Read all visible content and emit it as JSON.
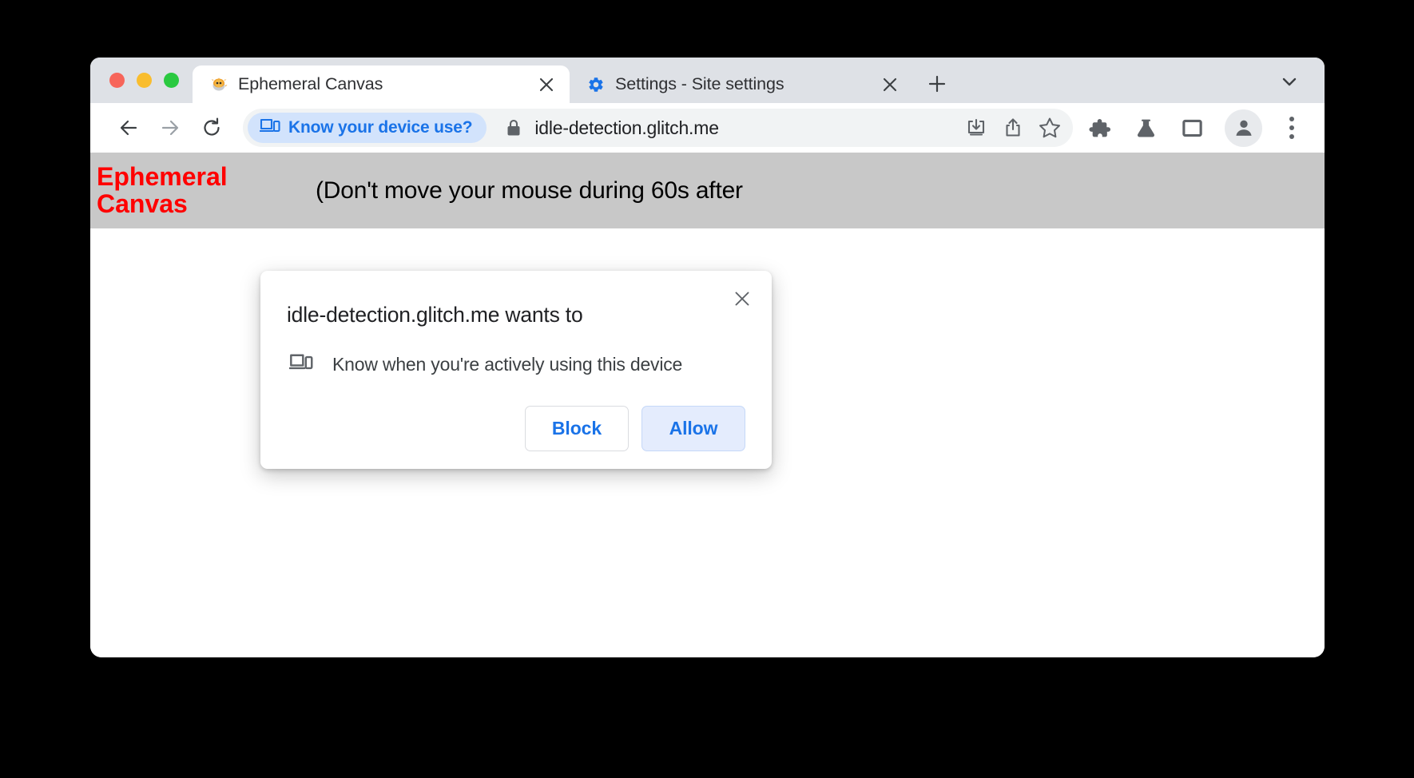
{
  "window": {
    "traffic_lights": [
      "close",
      "minimize",
      "maximize"
    ]
  },
  "tabstrip": {
    "tabs": [
      {
        "title": "Ephemeral Canvas",
        "favicon": "pufferfish-favicon",
        "favicon_glyph": "🐡",
        "active": true,
        "close_label": "✕"
      },
      {
        "title": "Settings - Site settings",
        "favicon": "gear-favicon",
        "favicon_glyph": "⚙",
        "active": false,
        "close_label": "✕"
      }
    ],
    "new_tab_label": "+",
    "tab_search_icon": "chevron-down-icon"
  },
  "toolbar": {
    "back_icon": "back-arrow-icon",
    "forward_icon": "forward-arrow-icon",
    "reload_icon": "reload-icon",
    "permission_chip": {
      "label": "Know your device use?",
      "icon": "device-idle-icon",
      "color": "#1a73e8",
      "background": "#d2e3fc"
    },
    "security_icon": "lock-icon",
    "url": "idle-detection.glitch.me",
    "omnibox_icons": [
      {
        "name": "install-app-icon"
      },
      {
        "name": "share-icon"
      },
      {
        "name": "bookmark-star-icon"
      }
    ],
    "action_icons": [
      {
        "name": "extensions-puzzle-icon"
      },
      {
        "name": "labs-flask-icon"
      },
      {
        "name": "side-panel-icon"
      }
    ],
    "avatar_icon": "profile-avatar-icon",
    "menu_icon": "three-dot-menu-icon"
  },
  "page": {
    "heading": "Ephemeral Canvas",
    "heading_color": "#ff0000",
    "banner_background": "#c8c8c8",
    "subtext": "(Don't move your mouse during 60s after"
  },
  "dialog": {
    "title": "idle-detection.glitch.me wants to",
    "close_label": "✕",
    "permission": {
      "icon": "device-idle-icon",
      "label": "Know when you're actively using this device"
    },
    "block_label": "Block",
    "allow_label": "Allow"
  }
}
